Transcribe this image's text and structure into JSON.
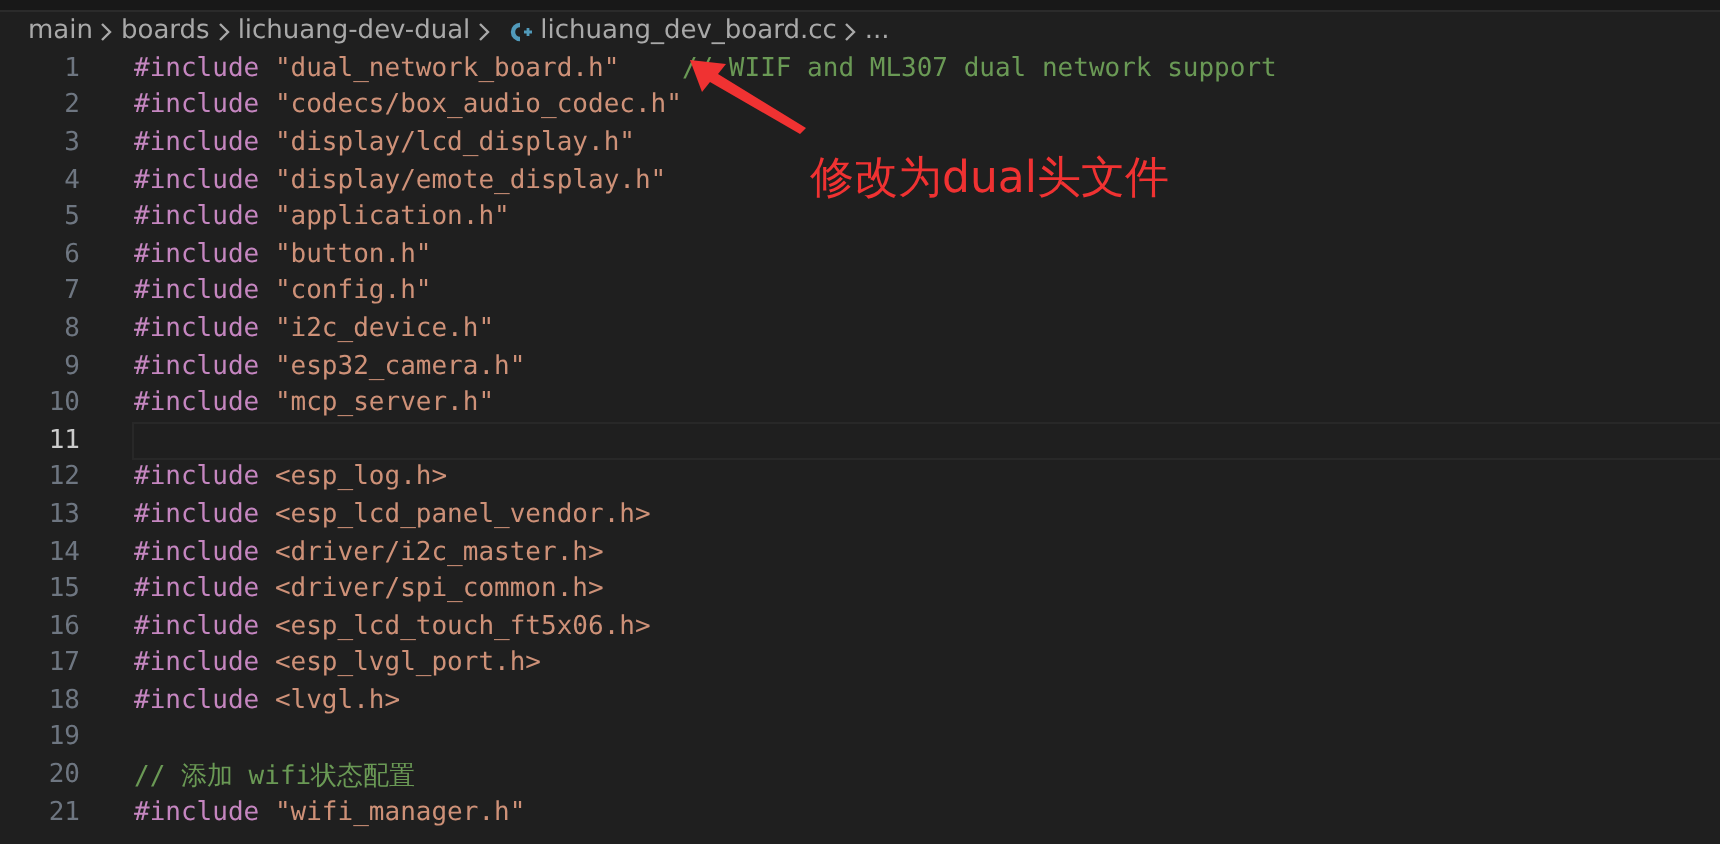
{
  "breadcrumb": {
    "items": [
      {
        "kind": "folder",
        "text": "main"
      },
      {
        "kind": "folder",
        "text": "boards"
      },
      {
        "kind": "folder",
        "text": "lichuang-dev-dual"
      },
      {
        "kind": "file",
        "text": "lichuang_dev_board.cc"
      },
      {
        "kind": "more",
        "text": "..."
      }
    ]
  },
  "lines": [
    {
      "number": "1",
      "current": false,
      "tokens": [
        {
          "kind": "keyword",
          "text": "#include"
        },
        {
          "kind": "string",
          "text": "\"dual_network_board.h\""
        },
        {
          "kind": "comment",
          "text": "    // WIIF and ML307 dual network support"
        }
      ]
    },
    {
      "number": "2",
      "current": false,
      "tokens": [
        {
          "kind": "keyword",
          "text": "#include"
        },
        {
          "kind": "string",
          "text": "\"codecs/box_audio_codec.h\""
        }
      ]
    },
    {
      "number": "3",
      "current": false,
      "tokens": [
        {
          "kind": "keyword",
          "text": "#include"
        },
        {
          "kind": "string",
          "text": "\"display/lcd_display.h\""
        }
      ]
    },
    {
      "number": "4",
      "current": false,
      "tokens": [
        {
          "kind": "keyword",
          "text": "#include"
        },
        {
          "kind": "string",
          "text": "\"display/emote_display.h\""
        }
      ]
    },
    {
      "number": "5",
      "current": false,
      "tokens": [
        {
          "kind": "keyword",
          "text": "#include"
        },
        {
          "kind": "string",
          "text": "\"application.h\""
        }
      ]
    },
    {
      "number": "6",
      "current": false,
      "tokens": [
        {
          "kind": "keyword",
          "text": "#include"
        },
        {
          "kind": "string",
          "text": "\"button.h\""
        }
      ]
    },
    {
      "number": "7",
      "current": false,
      "tokens": [
        {
          "kind": "keyword",
          "text": "#include"
        },
        {
          "kind": "string",
          "text": "\"config.h\""
        }
      ]
    },
    {
      "number": "8",
      "current": false,
      "tokens": [
        {
          "kind": "keyword",
          "text": "#include"
        },
        {
          "kind": "string",
          "text": "\"i2c_device.h\""
        }
      ]
    },
    {
      "number": "9",
      "current": false,
      "tokens": [
        {
          "kind": "keyword",
          "text": "#include"
        },
        {
          "kind": "string",
          "text": "\"esp32_camera.h\""
        }
      ]
    },
    {
      "number": "10",
      "current": false,
      "tokens": [
        {
          "kind": "keyword",
          "text": "#include"
        },
        {
          "kind": "string",
          "text": "\"mcp_server.h\""
        }
      ]
    },
    {
      "number": "11",
      "current": true
    },
    {
      "number": "12",
      "current": false,
      "tokens": [
        {
          "kind": "keyword",
          "text": "#include"
        },
        {
          "kind": "string",
          "text": "<esp_log.h>"
        }
      ]
    },
    {
      "number": "13",
      "current": false,
      "tokens": [
        {
          "kind": "keyword",
          "text": "#include"
        },
        {
          "kind": "string",
          "text": "<esp_lcd_panel_vendor.h>"
        }
      ]
    },
    {
      "number": "14",
      "current": false,
      "tokens": [
        {
          "kind": "keyword",
          "text": "#include"
        },
        {
          "kind": "string",
          "text": "<driver/i2c_master.h>"
        }
      ]
    },
    {
      "number": "15",
      "current": false,
      "tokens": [
        {
          "kind": "keyword",
          "text": "#include"
        },
        {
          "kind": "string",
          "text": "<driver/spi_common.h>"
        }
      ]
    },
    {
      "number": "16",
      "current": false,
      "tokens": [
        {
          "kind": "keyword",
          "text": "#include"
        },
        {
          "kind": "string",
          "text": "<esp_lcd_touch_ft5x06.h>"
        }
      ]
    },
    {
      "number": "17",
      "current": false,
      "tokens": [
        {
          "kind": "keyword",
          "text": "#include"
        },
        {
          "kind": "string",
          "text": "<esp_lvgl_port.h>"
        }
      ]
    },
    {
      "number": "18",
      "current": false,
      "tokens": [
        {
          "kind": "keyword",
          "text": "#include"
        },
        {
          "kind": "string",
          "text": "<lvgl.h>"
        }
      ]
    },
    {
      "number": "19",
      "current": false
    },
    {
      "number": "20",
      "current": false,
      "tokens": [
        {
          "kind": "comment",
          "text": "// 添加 wifi状态配置"
        }
      ]
    },
    {
      "number": "21",
      "current": false,
      "tokens": [
        {
          "kind": "keyword",
          "text": "#include"
        },
        {
          "kind": "string",
          "text": "\"wifi_manager.h\""
        }
      ]
    }
  ],
  "annotation": {
    "text": "修改为dual头文件"
  }
}
